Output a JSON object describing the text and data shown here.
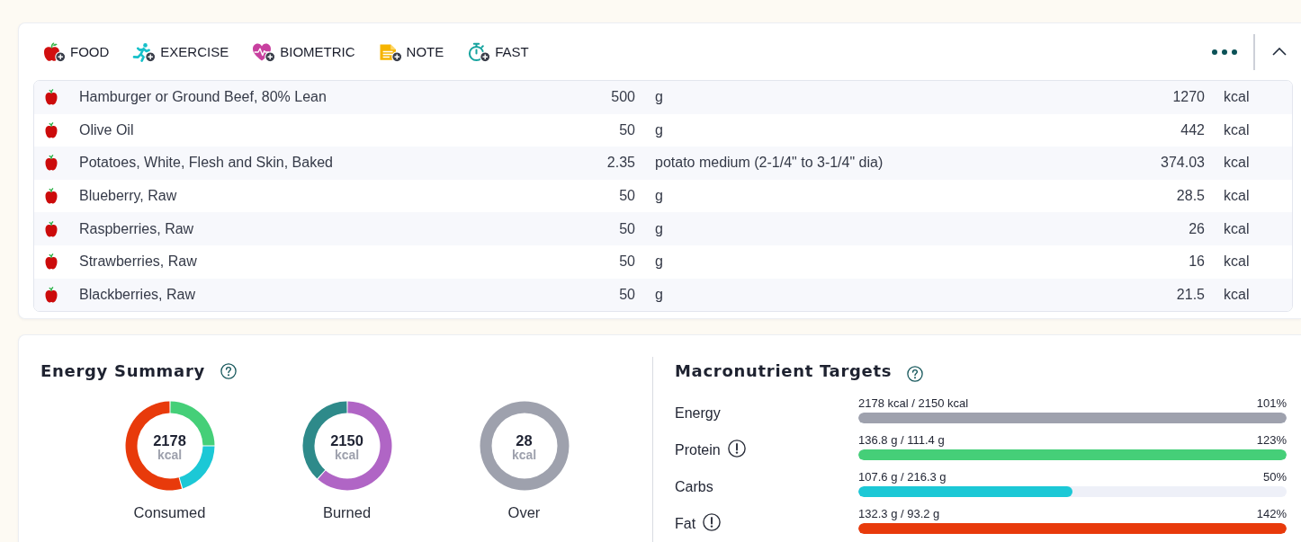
{
  "toolbar": {
    "actions": [
      {
        "kind": "food",
        "label": "FOOD"
      },
      {
        "kind": "exercise",
        "label": "EXERCISE"
      },
      {
        "kind": "biometric",
        "label": "BIOMETRIC"
      },
      {
        "kind": "note",
        "label": "NOTE"
      },
      {
        "kind": "fast",
        "label": "FAST"
      }
    ]
  },
  "food_log": {
    "expanded": true,
    "entries": [
      {
        "name": "Hamburger or Ground Beef, 80% Lean",
        "amount": "500",
        "unit": "g",
        "calories": "1270",
        "calorie_unit": "kcal"
      },
      {
        "name": "Olive Oil",
        "amount": "50",
        "unit": "g",
        "calories": "442",
        "calorie_unit": "kcal"
      },
      {
        "name": "Potatoes, White, Flesh and Skin, Baked",
        "amount": "2.35",
        "unit": "potato medium (2-1/4\" to 3-1/4\" dia)",
        "calories": "374.03",
        "calorie_unit": "kcal"
      },
      {
        "name": "Blueberry, Raw",
        "amount": "50",
        "unit": "g",
        "calories": "28.5",
        "calorie_unit": "kcal"
      },
      {
        "name": "Raspberries, Raw",
        "amount": "50",
        "unit": "g",
        "calories": "26",
        "calorie_unit": "kcal"
      },
      {
        "name": "Strawberries, Raw",
        "amount": "50",
        "unit": "g",
        "calories": "16",
        "calorie_unit": "kcal"
      },
      {
        "name": "Blackberries, Raw",
        "amount": "50",
        "unit": "g",
        "calories": "21.5",
        "calorie_unit": "kcal"
      }
    ]
  },
  "energy_summary": {
    "title": "Energy Summary",
    "donuts": [
      {
        "value": "2178",
        "unit": "kcal",
        "label": "Consumed"
      },
      {
        "value": "2150",
        "unit": "kcal",
        "label": "Burned"
      },
      {
        "value": "28",
        "unit": "kcal",
        "label": "Over"
      }
    ]
  },
  "macronutrient_targets": {
    "title": "Macronutrient Targets",
    "rows": [
      {
        "label": "Energy",
        "warning": false,
        "reading": "2178 kcal / 2150 kcal",
        "percent": "101%",
        "level": 1,
        "color": "#9ea1ad"
      },
      {
        "label": "Protein",
        "warning": true,
        "reading": "136.8 g / 111.4 g",
        "percent": "123%",
        "level": 1,
        "color": "#45cf78"
      },
      {
        "label": "Carbs",
        "warning": false,
        "reading": "107.6 g / 216.3 g",
        "percent": "50%",
        "level": 0.5,
        "color": "#1cc8d6"
      },
      {
        "label": "Fat",
        "warning": true,
        "reading": "132.3 g / 93.2 g",
        "percent": "142%",
        "level": 1,
        "color": "#e83a0b"
      }
    ]
  }
}
